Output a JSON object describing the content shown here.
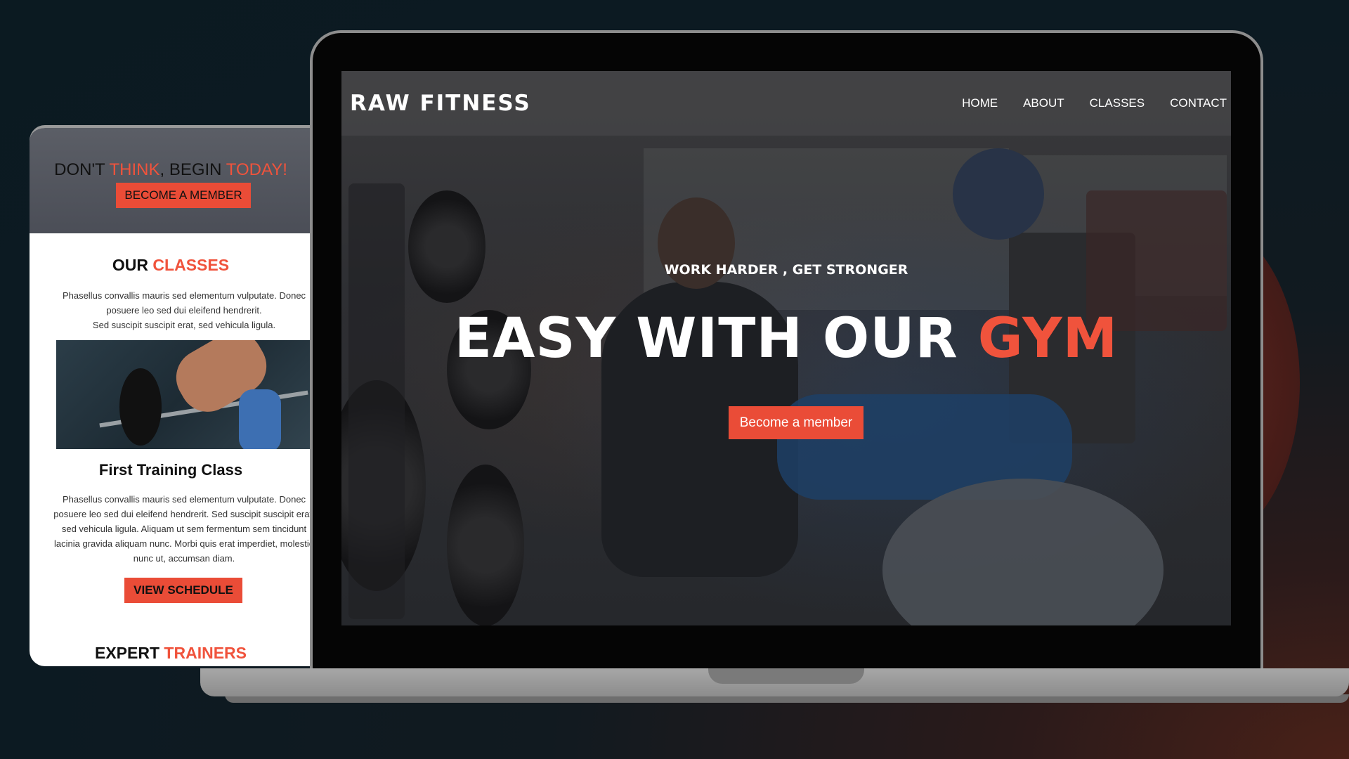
{
  "laptop_site": {
    "brand": "RAW FITNESS",
    "nav": [
      "HOME",
      "ABOUT",
      "CLASSES",
      "CONTACT"
    ],
    "tagline": "WORK HARDER , GET STRONGER",
    "title_main": "EASY WITH OUR",
    "title_accent": "GYM",
    "cta_label": "Become a member"
  },
  "mobile_site": {
    "header_title_parts": [
      "DON'T ",
      "THINK",
      ", BEGIN ",
      "TODAY!"
    ],
    "header_cta": "BECOME A MEMBER",
    "classes_title_a": "OUR ",
    "classes_title_b": "CLASSES",
    "classes_intro_1": "Phasellus convallis mauris sed elementum vulputate. Donec posuere leo sed dui eleifend hendrerit.",
    "classes_intro_2": "Sed suscipit suscipit erat, sed vehicula ligula.",
    "class_title": "First Training Class",
    "class_description": "Phasellus convallis mauris sed elementum vulputate. Donec posuere leo sed dui eleifend hendrerit. Sed suscipit suscipit erat, sed vehicula ligula. Aliquam ut sem fermentum sem tincidunt lacinia gravida aliquam nunc. Morbi quis erat imperdiet, molestie nunc ut, accumsan diam.",
    "schedule_button": "VIEW SCHEDULE",
    "trainers_title_a": "EXPERT ",
    "trainers_title_b": "TRAINERS"
  },
  "colors": {
    "accent": "#f0533c",
    "background": "#0c1a22"
  }
}
